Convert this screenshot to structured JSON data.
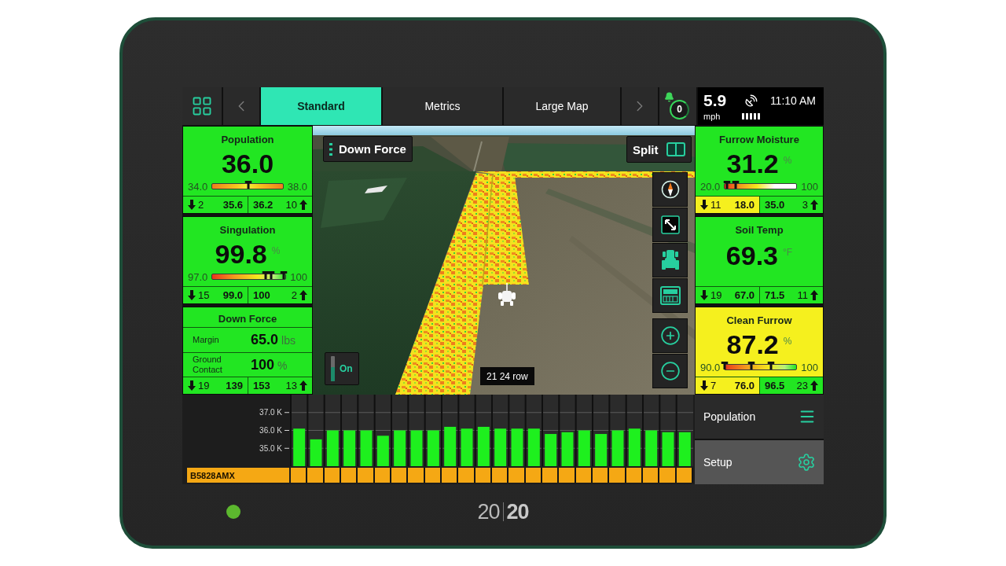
{
  "top_bar": {
    "tabs": [
      {
        "label": "Standard",
        "selected": true
      },
      {
        "label": "Metrics",
        "selected": false
      },
      {
        "label": "Large Map",
        "selected": false
      }
    ],
    "alerts": {
      "count": "0"
    },
    "status": {
      "speed": "5.9",
      "speed_unit": "mph",
      "time": "11:10 AM"
    }
  },
  "left_panels": [
    {
      "kind": "gauge",
      "title": "Population",
      "value": "36.0",
      "color": "#22e622",
      "gauge": {
        "kind": "target",
        "min": "34.0",
        "max": "38.0",
        "markers": [
          {
            "level": 0.51
          }
        ]
      },
      "stats": {
        "below": {
          "count": "2",
          "value": "35.6",
          "color": "#22e622"
        },
        "above": {
          "value": "36.2",
          "count": "10",
          "color": "#22e622"
        }
      }
    },
    {
      "kind": "gauge",
      "title": "Singulation",
      "value": "99.8",
      "unit": "%",
      "color": "#22e622",
      "gauge": {
        "kind": "rising",
        "min": "97.0",
        "max": "100",
        "markers": [
          {
            "level": 0.73
          },
          {
            "level": 0.8
          },
          {
            "level": 0.97
          }
        ]
      },
      "stats": {
        "below": {
          "count": "15",
          "value": "99.0",
          "color": "#22e622"
        },
        "above": {
          "value": "100",
          "count": "2",
          "color": "#22e622"
        }
      }
    },
    {
      "kind": "rows",
      "title": "Down Force",
      "color": "#22e622",
      "rows": [
        {
          "label": "Margin",
          "value": "65.0",
          "unit": "lbs"
        },
        {
          "label": "Ground Contact",
          "value": "100",
          "unit": "%"
        }
      ],
      "stats": {
        "below": {
          "count": "19",
          "value": "139",
          "color": "#22e622"
        },
        "above": {
          "value": "153",
          "count": "13",
          "color": "#22e622"
        }
      }
    }
  ],
  "map": {
    "layer_button": "Down Force",
    "split_button": "Split",
    "toggle": {
      "label": "On",
      "on": true
    },
    "row_label": "21 24 row"
  },
  "right_panels": [
    {
      "kind": "gauge",
      "title": "Furrow Moisture",
      "value": "31.2",
      "unit": "%",
      "color": "#22e622",
      "gauge": {
        "kind": "fading",
        "min": "20.0",
        "max": "100",
        "markers": [
          {
            "level": 0.03
          },
          {
            "level": 0.15
          }
        ]
      },
      "stats": {
        "below": {
          "count": "11",
          "value": "18.0",
          "color": "#f5f01e"
        },
        "above": {
          "value": "35.0",
          "count": "3",
          "color": "#22e622"
        }
      }
    },
    {
      "kind": "plain",
      "title": "Soil Temp",
      "value": "69.3",
      "unit": "°F",
      "color": "#22e622",
      "stats": {
        "below": {
          "count": "19",
          "value": "67.0",
          "color": "#22e622"
        },
        "above": {
          "value": "71.5",
          "count": "11",
          "color": "#22e622"
        }
      }
    },
    {
      "kind": "gauge",
      "title": "Clean Furrow",
      "value": "87.2",
      "unit": "%",
      "color": "#f5f01e",
      "gauge": {
        "kind": "rising",
        "min": "90.0",
        "max": "100",
        "markers": [
          {
            "level": 0
          },
          {
            "level": 0.37
          },
          {
            "level": 0.64
          }
        ]
      },
      "stats": {
        "below": {
          "count": "7",
          "value": "76.0",
          "color": "#f5f01e"
        },
        "above": {
          "value": "96.5",
          "count": "23",
          "color": "#22e622"
        }
      }
    }
  ],
  "row_chart": {
    "hybrid": "B5828AMX",
    "chart_data": {
      "type": "bar",
      "values": [
        36.1,
        35.5,
        36.0,
        36.0,
        36.0,
        35.7,
        36.0,
        36.0,
        36.0,
        36.2,
        36.1,
        36.2,
        36.1,
        36.1,
        36.1,
        35.8,
        35.9,
        36.0,
        35.8,
        36.0,
        36.1,
        36.0,
        35.9,
        35.9
      ],
      "ylim": [
        34,
        38
      ],
      "yticks": [
        {
          "value": 35,
          "label": "35.0 K"
        },
        {
          "value": 36,
          "label": "36.0 K"
        },
        {
          "value": 37,
          "label": "37.0 K"
        }
      ],
      "grid": true
    }
  },
  "side_menu": [
    {
      "kind": "layers",
      "label": "Population"
    },
    {
      "kind": "setup",
      "label": "Setup"
    }
  ],
  "device": {
    "power_led": {
      "on": true
    },
    "logo": {
      "light_part": "20",
      "bold_part": "20"
    }
  }
}
